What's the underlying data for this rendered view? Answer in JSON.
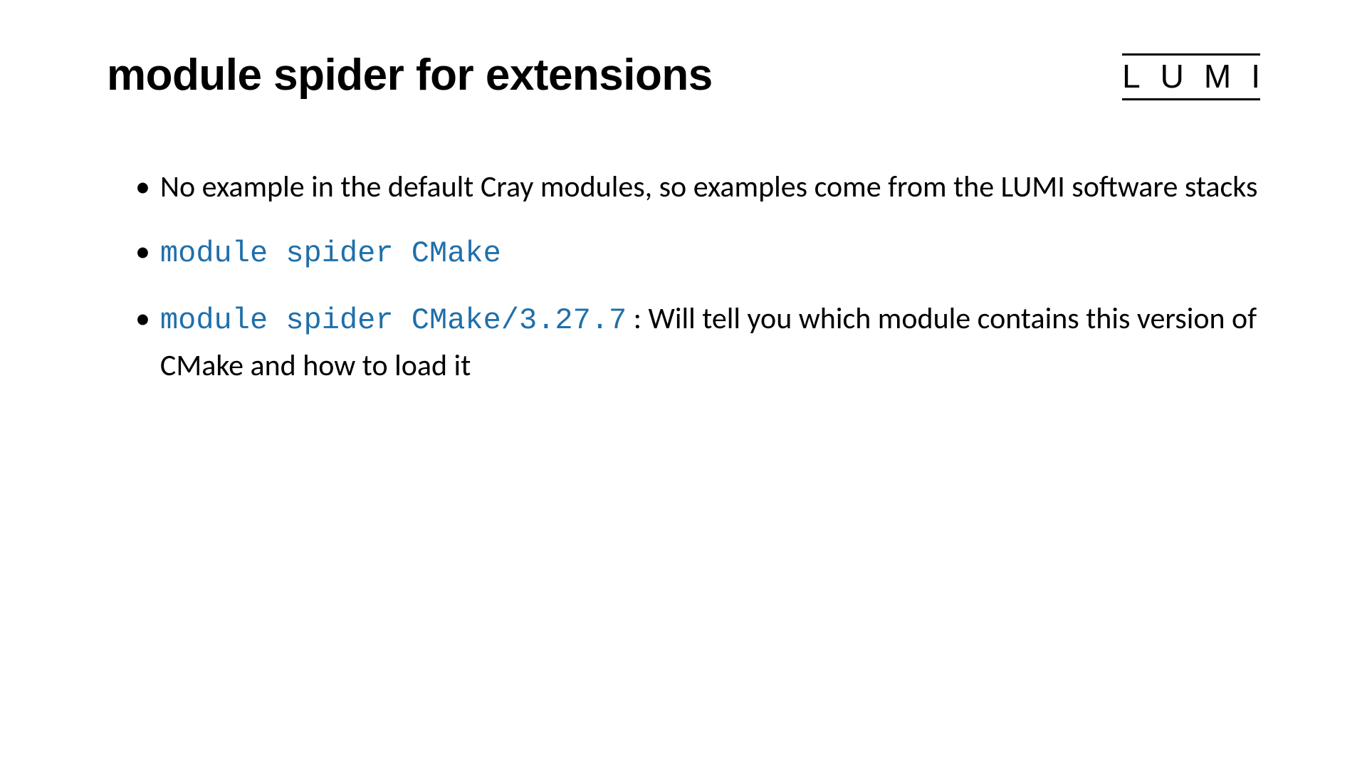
{
  "title": "module spider for extensions",
  "logo": "LUMI",
  "bullets": {
    "b1": {
      "text": "No example in the default Cray modules, so examples come from the LUMI software stacks"
    },
    "b2": {
      "code": "module spider CMake"
    },
    "b3": {
      "code": "module spider CMake/3.27.7",
      "tail": " : Will tell you which module contains this version of CMake and how to load it"
    }
  }
}
